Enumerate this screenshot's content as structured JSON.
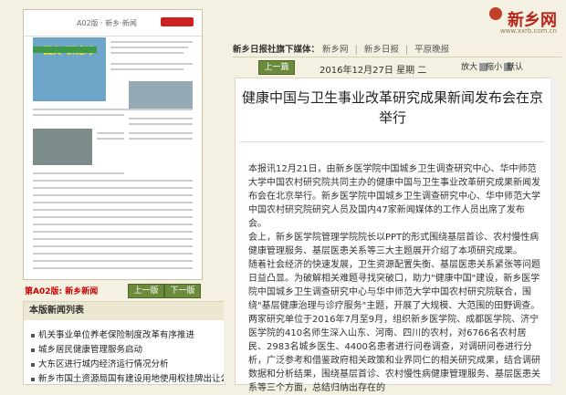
{
  "thumbnail": {
    "section_label": "A02版 · 新乡·新闻",
    "banner_text": "\"国文\"讲述时",
    "caption": "第A02版: 新乡新闻",
    "prev_label": "上一版",
    "next_label": "下一版"
  },
  "news_list": {
    "title": "本版新闻列表",
    "items": [
      "机关事业单位养老保险制度改革有序推进",
      "城乡居民健康管理服务启动",
      "大东区进行城内经济运行情况分析",
      "新乡市国土资源局国有建设用地使用权挂牌出让公"
    ]
  },
  "site": {
    "logo_text": "新乡网",
    "logo_url": "www.xxrb.com.cn"
  },
  "nav": {
    "prefix": "新乡日报社旗下媒体：",
    "links": [
      "新乡网",
      "新乡日报",
      "平原晚报"
    ]
  },
  "toolbar": {
    "prev_label": "上一篇",
    "date": "2016年12月27日 星期 二",
    "zoom_in": "放大",
    "zoom_out": "缩小",
    "zoom_reset": "默认"
  },
  "article": {
    "title": "健康中国与卫生事业改革研究成果新闻发布会在京举行",
    "paragraphs": [
      "本报讯12月21日，由新乡医学院中国城乡卫生调查研究中心、华中师范大学中国农村研究院共同主办的健康中国与卫生事业改革研究成果新闻发布会在北京举行。新乡医学院中国城乡卫生调查研究中心、华中师范大学中国农村研究院研究人员及国内47家新闻媒体的工作人员出席了发布会。",
      "会上，新乡医学院管理学院院长以PPT的形式围绕基层首诊、农村慢性病健康管理服务、基层医患关系等三大主题展开介绍了本项研究成果。",
      "随着社会经济的快速发展，卫生资源配置失衡、基层医患关系紧张等问题日益凸显。为破解相关难题寻找突破口，助力\"健康中国\"建设，新乡医学院中国城乡卫生调查研究中心与华中师范大学中国农村研究院联合，围绕\"基层健康治理与诊疗服务\"主题，开展了大规模、大范围的田野调查。两家研究单位于2016年7月至9月，组织新乡医学院、成都医学院、济宁医学院的410名师生深入山东、河南、四川的农村，对6766名农村居民、2983名城乡医生、4400名患者进行问卷调查，对调研问卷进行分析，广泛参考和借鉴政府相关政策和业界同仁的相关研究成果，结合调研数据和分析结果，围绕基层首诊、农村慢性病健康管理服务、基层医患关系等三个方面，总结归纳出存在的"
    ]
  }
}
